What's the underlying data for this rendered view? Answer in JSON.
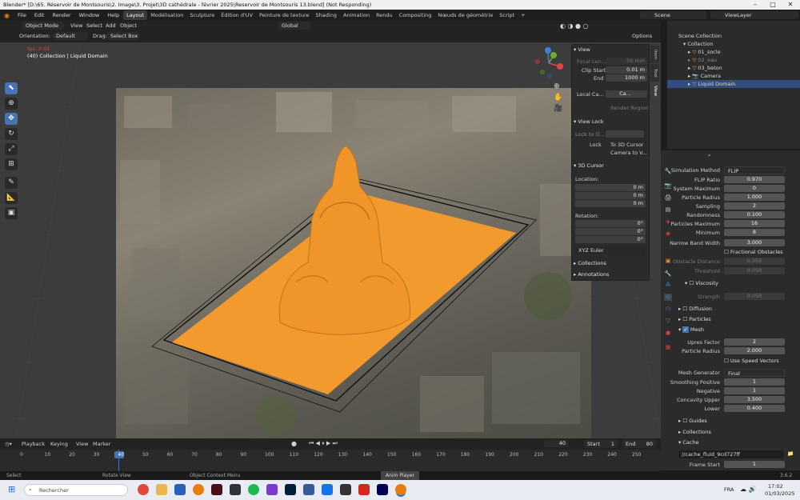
{
  "titlebar": {
    "title": "Blender* [D:\\65. Réservoir de Montsouris\\2. Image\\3. Projet\\3D cathédrale - février 2025\\Reservoir de Montsouris 13.blend] (Not Responding)"
  },
  "menu": {
    "items": [
      "File",
      "Edit",
      "Render",
      "Window",
      "Help"
    ],
    "workspaces": [
      "Layout",
      "Modélisation",
      "Sculpture",
      "Édition d'UV",
      "Peinture de texture",
      "Shading",
      "Animation",
      "Rendu",
      "Compositing",
      "Nœuds de géométrie",
      "Script"
    ],
    "active_workspace": "Layout",
    "scene": "Scene",
    "view_layer": "ViewLayer"
  },
  "header": {
    "mode": "Object Mode",
    "view": "View",
    "select": "Select",
    "add": "Add",
    "object": "Object",
    "orientation_label": "Orientation:",
    "orientation_value": "Default",
    "drag_label": "Drag:",
    "drag_value": "Select Box",
    "transform": "Global",
    "options": "Options"
  },
  "viewport": {
    "fps": "fps: 0.01",
    "info": "(40) Collection | Liquid Domain",
    "colors": {
      "mesh": "#f29a2e",
      "accent": "#4772b3"
    }
  },
  "npanel": {
    "view_title": "View",
    "focal_label": "Focal Len...",
    "focal_value": "50 mm",
    "clip_start_label": "Clip Start",
    "clip_start_value": "0.01 m",
    "end_label": "End",
    "end_value": "1000 m",
    "local_cam_label": "Local Ca...",
    "local_cam_value": "Ca...",
    "render_region": "Render Region",
    "view_lock_title": "View Lock",
    "lock_to_label": "Lock to O...",
    "lock_label": "Lock",
    "to_3d_cursor": "To 3D Cursor",
    "camera_to_view": "Camera to V...",
    "cursor_title": "3D Cursor",
    "location_label": "Location:",
    "loc": [
      {
        "axis": "X",
        "value": "0 m"
      },
      {
        "axis": "Y",
        "value": "0 m"
      },
      {
        "axis": "Z",
        "value": "0 m"
      }
    ],
    "rotation_label": "Rotation:",
    "rot": [
      {
        "axis": "X",
        "value": "0°"
      },
      {
        "axis": "Y",
        "value": "0°"
      },
      {
        "axis": "Z",
        "value": "0°"
      }
    ],
    "euler": "XYZ Euler",
    "collections": "Collections",
    "annotations": "Annotations"
  },
  "sidetabs": [
    "Item",
    "Tool",
    "View"
  ],
  "outliner": {
    "scene_collection": "Scene Collection",
    "collection": "Collection",
    "items": [
      "01_socle",
      "02_eau",
      "03_beton",
      "Camera",
      "Liquid Domain"
    ],
    "selected": "Liquid Domain"
  },
  "props": {
    "rows1": [
      {
        "label": "Simulation Method",
        "value": "FLIP"
      },
      {
        "label": "FLIP Ratio",
        "value": "0.970"
      },
      {
        "label": "System Maximum",
        "value": "0"
      },
      {
        "label": "Particle Radius",
        "value": "1.000"
      },
      {
        "label": "Sampling",
        "value": "2"
      },
      {
        "label": "Randomness",
        "value": "0.100"
      },
      {
        "label": "Particles Maximum",
        "value": "16"
      },
      {
        "label": "Minimum",
        "value": "8"
      },
      {
        "label": "Narrow Band Width",
        "value": "3.000"
      }
    ],
    "fractional": "Fractional Obstacles",
    "obstacle_distance_label": "Obstacle Distance",
    "obstacle_distance_value": "0.050",
    "threshold_label": "Threshold",
    "threshold_value": "0.050",
    "viscosity": "Viscosity",
    "strength_label": "Strength",
    "strength_value": "0.050",
    "diffusion": "Diffusion",
    "particles": "Particles",
    "mesh": "Mesh",
    "upres_label": "Upres Factor",
    "upres_value": "2",
    "mesh_radius_label": "Particle Radius",
    "mesh_radius_value": "2.000",
    "speed_vectors": "Use Speed Vectors",
    "rows2": [
      {
        "label": "Mesh Generator",
        "value": "Final"
      },
      {
        "label": "Smoothing Positive",
        "value": "1"
      },
      {
        "label": "Negative",
        "value": "1"
      },
      {
        "label": "Concavity Upper",
        "value": "3.500"
      },
      {
        "label": "Lower",
        "value": "0.400"
      }
    ],
    "guides": "Guides",
    "collections": "Collections",
    "cache": "Cache",
    "cache_path": "//cache_fluid_9cd727ff",
    "frame_start_label": "Frame Start",
    "frame_start_value": "1"
  },
  "timeline": {
    "playback": "Playback",
    "keying": "Keying",
    "view": "View",
    "marker": "Marker",
    "current": "40",
    "start_label": "Start",
    "start": "1",
    "end_label": "End",
    "end": "80",
    "ticks": [
      "0",
      "10",
      "20",
      "30",
      "40",
      "50",
      "60",
      "70",
      "80",
      "90",
      "100",
      "110",
      "120",
      "130",
      "140",
      "150",
      "160",
      "170",
      "180",
      "190",
      "200",
      "210",
      "220",
      "230",
      "240",
      "250"
    ]
  },
  "status": {
    "select": "Select",
    "rotate": "Rotate View",
    "context": "Object Context Menu",
    "anim": "Anim Player",
    "version": "3.6.2"
  },
  "taskbar": {
    "search": "Rechercher",
    "lang": "FRA",
    "time": "17:02",
    "date": "01/03/2025"
  }
}
